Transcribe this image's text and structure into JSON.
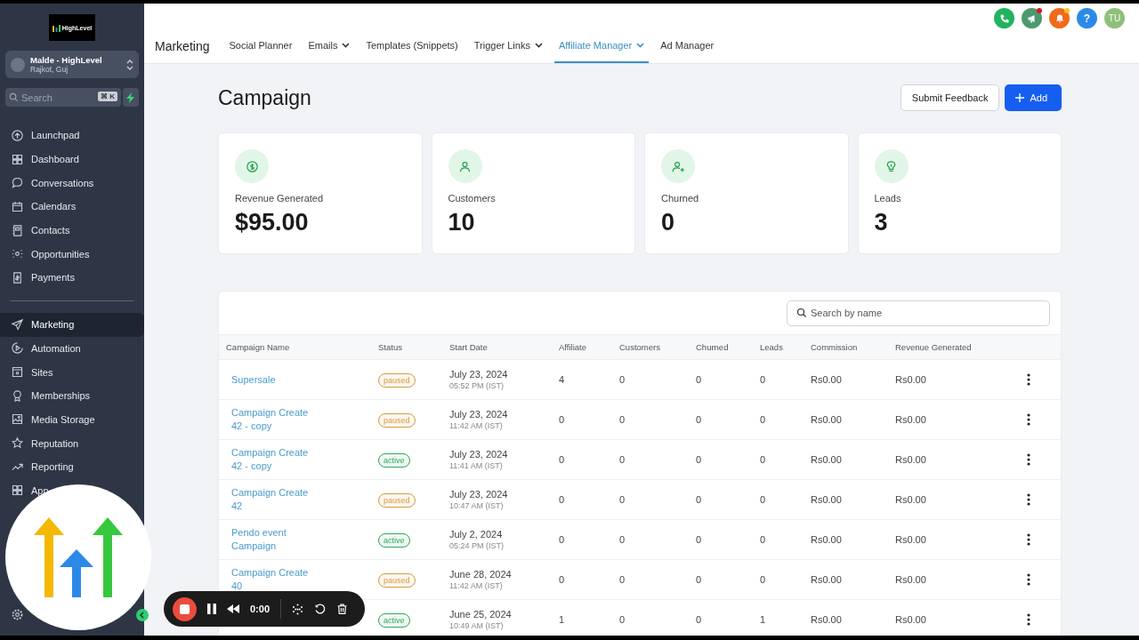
{
  "sidebar": {
    "logo": "HighLevel",
    "account": {
      "name": "Malde - HighLevel",
      "location": "Rajkot, Guj"
    },
    "search": {
      "placeholder": "Search",
      "shortcut": "⌘ K"
    },
    "items": [
      {
        "label": "Launchpad",
        "selected": false
      },
      {
        "label": "Dashboard",
        "selected": false
      },
      {
        "label": "Conversations",
        "selected": false
      },
      {
        "label": "Calendars",
        "selected": false
      },
      {
        "label": "Contacts",
        "selected": false
      },
      {
        "label": "Opportunities",
        "selected": false
      },
      {
        "label": "Payments",
        "selected": false
      }
    ],
    "items_2": [
      {
        "label": "Marketing",
        "selected": true
      },
      {
        "label": "Automation",
        "selected": false
      },
      {
        "label": "Sites",
        "selected": false
      },
      {
        "label": "Memberships",
        "selected": false
      },
      {
        "label": "Media Storage",
        "selected": false
      },
      {
        "label": "Reputation",
        "selected": false
      },
      {
        "label": "Reporting",
        "selected": false
      },
      {
        "label": "App",
        "selected": false
      }
    ]
  },
  "header": {
    "section": "Marketing",
    "help": "?",
    "avatar": "TU",
    "tabs": [
      {
        "label": "Social Planner",
        "dropdown": false,
        "selected": false
      },
      {
        "label": "Emails",
        "dropdown": true,
        "selected": false
      },
      {
        "label": "Templates (Snippets)",
        "dropdown": false,
        "selected": false
      },
      {
        "label": "Trigger Links",
        "dropdown": true,
        "selected": false
      },
      {
        "label": "Affiliate Manager",
        "dropdown": true,
        "selected": true
      },
      {
        "label": "Ad Manager",
        "dropdown": false,
        "selected": false
      }
    ]
  },
  "page": {
    "title": "Campaign",
    "buttons": [
      "Submit Feedback",
      "Add"
    ]
  },
  "stats": [
    {
      "label": "Revenue Generated",
      "value": "$95.00"
    },
    {
      "label": "Customers",
      "value": "10"
    },
    {
      "label": "Churned",
      "value": "0"
    },
    {
      "label": "Leads",
      "value": "3"
    }
  ],
  "table": {
    "search": {
      "placeholder": "Search by name"
    },
    "columns": [
      "Campaign Name",
      "Status",
      "Start Date",
      "Affiliate",
      "Customers",
      "Churned",
      "Leads",
      "Commission",
      "Revenue Generated"
    ],
    "rows": [
      {
        "name": "Supersale",
        "status": "paused",
        "color": "#d69a3c",
        "date": "July 23, 2024",
        "time": "05:52 PM (IST)",
        "affiliate": "4",
        "customers": "0",
        "churned": "0",
        "leads": "0",
        "commission": "Rs0.00",
        "revenue": "Rs0.00"
      },
      {
        "name": "Campaign Create 42 - copy",
        "status": "paused",
        "color": "#d69a3c",
        "date": "July 23, 2024",
        "time": "11:42 AM (IST)",
        "affiliate": "0",
        "customers": "0",
        "churned": "0",
        "leads": "0",
        "commission": "Rs0.00",
        "revenue": "Rs0.00"
      },
      {
        "name": "Campaign Create 42 - copy",
        "status": "active",
        "color": "#2fa95f",
        "date": "July 23, 2024",
        "time": "11:41 AM (IST)",
        "affiliate": "0",
        "customers": "0",
        "churned": "0",
        "leads": "0",
        "commission": "Rs0.00",
        "revenue": "Rs0.00"
      },
      {
        "name": "Campaign Create 42",
        "status": "paused",
        "color": "#d69a3c",
        "date": "July 23, 2024",
        "time": "10:47 AM (IST)",
        "affiliate": "0",
        "customers": "0",
        "churned": "0",
        "leads": "0",
        "commission": "Rs0.00",
        "revenue": "Rs0.00"
      },
      {
        "name": "Pendo event Campaign",
        "status": "active",
        "color": "#2fa95f",
        "date": "July 2, 2024",
        "time": "05:24 PM (IST)",
        "affiliate": "0",
        "customers": "0",
        "churned": "0",
        "leads": "0",
        "commission": "Rs0.00",
        "revenue": "Rs0.00"
      },
      {
        "name": "Campaign Create 40",
        "status": "paused",
        "color": "#d69a3c",
        "date": "June 28, 2024",
        "time": "11:42 AM (IST)",
        "affiliate": "0",
        "customers": "0",
        "churned": "0",
        "leads": "0",
        "commission": "Rs0.00",
        "revenue": "Rs0.00"
      },
      {
        "status": "active",
        "color": "#2fa95f",
        "date": "June 25, 2024",
        "time": "10:49 AM (IST)",
        "affiliate": "1",
        "customers": "0",
        "churned": "0",
        "leads": "1",
        "commission": "Rs0.00",
        "revenue": "Rs0.00"
      }
    ]
  },
  "recorder": {
    "time": "0:00"
  }
}
